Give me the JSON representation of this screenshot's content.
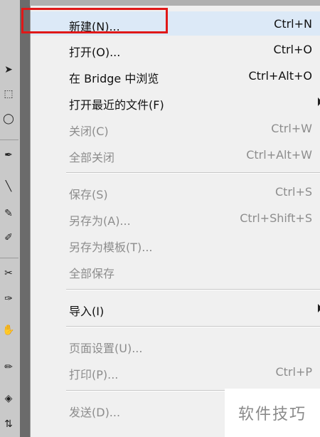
{
  "menu": {
    "items": [
      {
        "label": "新建(N)...",
        "shortcut": "Ctrl+N"
      },
      {
        "label": "打开(O)...",
        "shortcut": "Ctrl+O"
      },
      {
        "label": "在 Bridge 中浏览",
        "shortcut": "Ctrl+Alt+O"
      },
      {
        "label": "打开最近的文件(F)",
        "shortcut": ""
      },
      {
        "label": "关闭(C)",
        "shortcut": "Ctrl+W"
      },
      {
        "label": "全部关闭",
        "shortcut": "Ctrl+Alt+W"
      },
      {
        "label": "保存(S)",
        "shortcut": "Ctrl+S"
      },
      {
        "label": "另存为(A)...",
        "shortcut": "Ctrl+Shift+S"
      },
      {
        "label": "另存为模板(T)...",
        "shortcut": ""
      },
      {
        "label": "全部保存",
        "shortcut": ""
      },
      {
        "label": "导入(I)",
        "shortcut": ""
      },
      {
        "label": "页面设置(U)...",
        "shortcut": ""
      },
      {
        "label": "打印(P)...",
        "shortcut": "Ctrl+P"
      },
      {
        "label": "发送(D)...",
        "shortcut": ""
      }
    ]
  },
  "watermark": {
    "text": "软件技巧"
  },
  "colors": {
    "highlight_border": "#e01818",
    "menu_bg": "#f0f0f0",
    "disabled_text": "#8d8d8d"
  }
}
